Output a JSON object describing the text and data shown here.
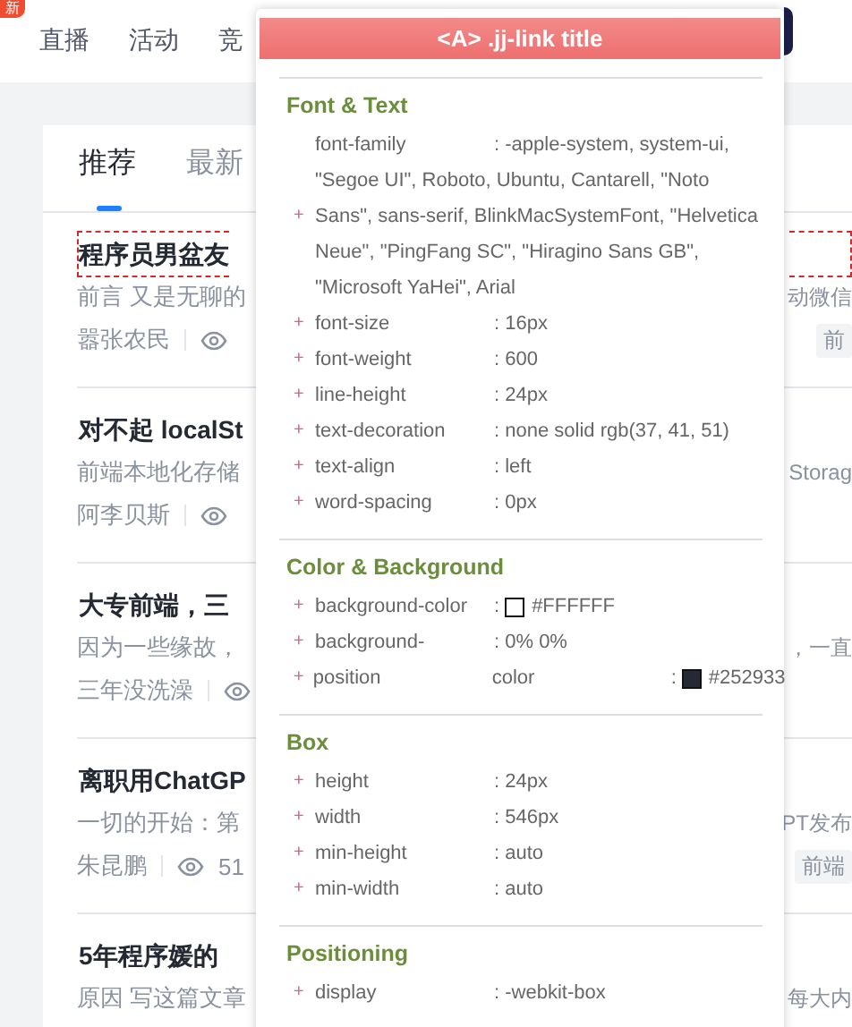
{
  "header": {
    "badge": "新",
    "nav": [
      {
        "label": "直播",
        "selected": false
      },
      {
        "label": "活动",
        "selected": false
      },
      {
        "label": "竞",
        "selected": false
      }
    ]
  },
  "feed_tabs": [
    {
      "label": "推荐",
      "selected": true
    },
    {
      "label": "最新",
      "selected": false
    }
  ],
  "articles": [
    {
      "title": "程序员男盆友",
      "highlighted": true,
      "excerpt": "前言 又是无聊的",
      "excerpt_end": "动微信",
      "author": "嚣张农民",
      "tag": "前"
    },
    {
      "title": "对不起 localSt",
      "highlighted": false,
      "excerpt": "前端本地化存储",
      "excerpt_end": "Storag",
      "author": "阿李贝斯"
    },
    {
      "title": "大专前端，三",
      "highlighted": false,
      "excerpt": "因为一些缘故，",
      "excerpt_end": "，一直",
      "author": "三年没洗澡"
    },
    {
      "title": "离职用ChatGP",
      "highlighted": false,
      "excerpt": "一切的开始：第",
      "excerpt_end": "PT发布",
      "author": "朱昆鹏",
      "views": "51",
      "tag": "前端"
    },
    {
      "title": "5年程序媛的",
      "highlighted": false,
      "excerpt": "原因 写这篇文章",
      "excerpt_end": "每大内"
    }
  ],
  "inspector": {
    "title": "<A> .jj-link title",
    "sections": [
      {
        "title": "Font & Text",
        "props": [
          {
            "kind": "text",
            "marker": "+",
            "name": "font-family",
            "value": ": -apple-system, system-ui, \"Segoe UI\", Roboto, Ubuntu, Cantarell, \"Noto Sans\", sans-serif, BlinkMacSystemFont, \"Helvetica Neue\", \"PingFang SC\", \"Hiragino Sans GB\", \"Microsoft YaHei\", Arial"
          },
          {
            "kind": "text",
            "marker": "+",
            "name": "font-size",
            "value": ": 16px"
          },
          {
            "kind": "text",
            "marker": "+",
            "name": "font-weight",
            "value": ": 600"
          },
          {
            "kind": "text",
            "marker": "+",
            "name": "line-height",
            "value": ": 24px"
          },
          {
            "kind": "text",
            "marker": "+",
            "name": "text-decoration",
            "value": ": none solid rgb(37, 41, 51)"
          },
          {
            "kind": "text",
            "marker": "+",
            "name": "text-align",
            "value": ": left"
          },
          {
            "kind": "text",
            "marker": "+",
            "name": "word-spacing",
            "value": ": 0px"
          }
        ]
      },
      {
        "title": "Color & Background",
        "props": [
          {
            "kind": "color",
            "marker": "+",
            "name": "background-color",
            "colon": ":",
            "value": "#FFFFFF"
          },
          {
            "kind": "text",
            "marker": "+",
            "name": "background-",
            "value": ": 0% 0%"
          },
          {
            "kind": "color",
            "marker": "+",
            "name": "position",
            "extra": "color",
            "colon": ":",
            "value": "#252933"
          }
        ]
      },
      {
        "title": "Box",
        "props": [
          {
            "kind": "text",
            "marker": "+",
            "name": "height",
            "value": ": 24px"
          },
          {
            "kind": "text",
            "marker": "+",
            "name": "width",
            "value": ": 546px"
          },
          {
            "kind": "text",
            "marker": "+",
            "name": "min-height",
            "value": ": auto"
          },
          {
            "kind": "text",
            "marker": "+",
            "name": "min-width",
            "value": ": auto"
          }
        ]
      },
      {
        "title": "Positioning",
        "props": [
          {
            "kind": "text",
            "marker": "+",
            "name": "display",
            "value": ": -webkit-box"
          }
        ]
      }
    ]
  }
}
